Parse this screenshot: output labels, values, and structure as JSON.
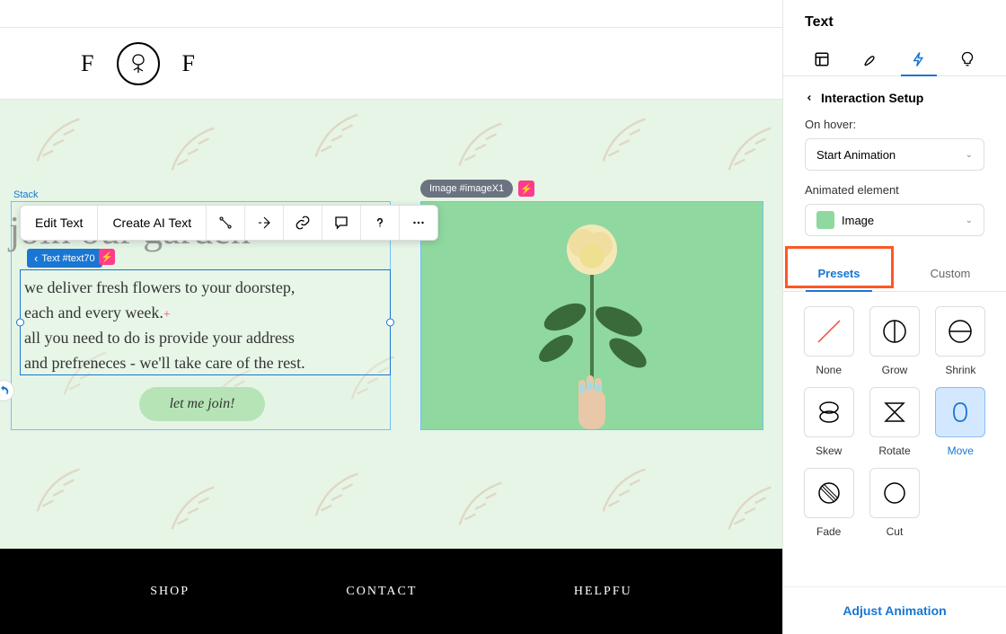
{
  "header": {
    "logo_left": "F",
    "logo_right": "F"
  },
  "canvas": {
    "stack_label": "Stack",
    "heading": "join our garden",
    "text_badge": "Text #text70",
    "image_badge": "Image #imageX1",
    "body_line1": "we deliver fresh flowers to your doorstep,",
    "body_line2": "each and every week.",
    "body_line3": "all you need to do is provide your address",
    "body_line4": "and prefreneces - we'll take care of the rest.",
    "join_button": "let me join!"
  },
  "toolbar": {
    "edit_text": "Edit Text",
    "create_ai": "Create AI Text"
  },
  "footer": {
    "shop": "SHOP",
    "contact": "CONTACT",
    "helpful": "HELPFU"
  },
  "panel": {
    "title": "Text",
    "back": "Interaction Setup",
    "on_hover_label": "On hover:",
    "on_hover_value": "Start Animation",
    "animated_label": "Animated element",
    "animated_value": "Image",
    "tab_presets": "Presets",
    "tab_custom": "Custom",
    "presets": {
      "none": "None",
      "grow": "Grow",
      "shrink": "Shrink",
      "skew": "Skew",
      "rotate": "Rotate",
      "move": "Move",
      "fade": "Fade",
      "cut": "Cut"
    },
    "adjust": "Adjust Animation"
  }
}
